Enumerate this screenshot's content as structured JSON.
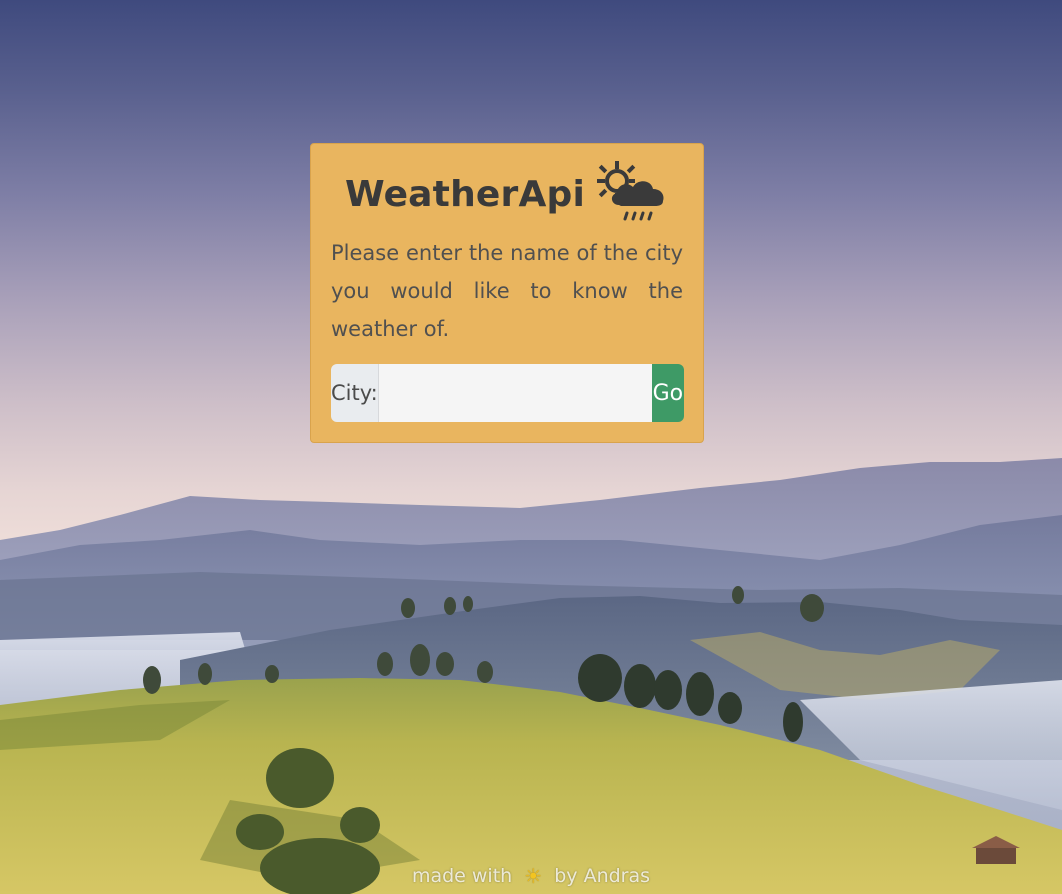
{
  "card": {
    "title": "WeatherApi",
    "icon": "sun-cloud-rain-icon",
    "prompt": "Please enter the name of the city you would like to know the weather of."
  },
  "form": {
    "city_label": "City:",
    "city_value": "",
    "city_placeholder": "",
    "go_label": "Go"
  },
  "footer": {
    "prefix": "made with",
    "emoji": "☀",
    "suffix": "by Andras"
  },
  "colors": {
    "card_bg": "#e9b55f",
    "go_button": "#3e9a66",
    "addon_bg": "#e9ecef"
  }
}
